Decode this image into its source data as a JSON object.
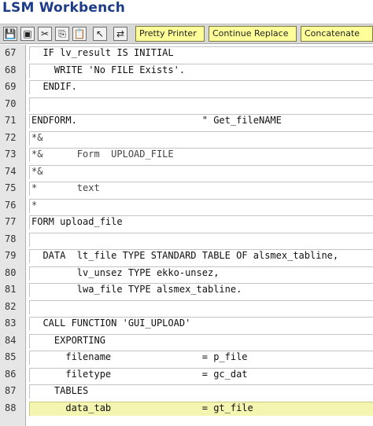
{
  "app": {
    "title": "LSM Workbench"
  },
  "toolbar": {
    "icons": [
      {
        "name": "save-icon",
        "glyph": "💾"
      },
      {
        "name": "window-icon",
        "glyph": "▣"
      },
      {
        "name": "cut-icon",
        "glyph": "✂"
      },
      {
        "name": "copy-icon",
        "glyph": "⎘"
      },
      {
        "name": "paste-icon",
        "glyph": "📋"
      },
      {
        "name": "pointer-icon",
        "glyph": "↖"
      },
      {
        "name": "replace-icon",
        "glyph": "⇄"
      }
    ],
    "buttons": [
      {
        "name": "pretty-printer-button",
        "label": "Pretty Printer"
      },
      {
        "name": "continue-replace-button",
        "label": "Continue Replace"
      },
      {
        "name": "concatenate-button",
        "label": "Concatenate"
      }
    ]
  },
  "editor": {
    "highlight_color": "#f3f5b0",
    "lines": [
      {
        "num": "67",
        "text": "  IF lv_result IS INITIAL"
      },
      {
        "num": "68",
        "text": "    WRITE 'No FILE Exists'."
      },
      {
        "num": "69",
        "text": "  ENDIF."
      },
      {
        "num": "70",
        "text": ""
      },
      {
        "num": "71",
        "text": "ENDFORM.                      \" Get_fileNAME"
      },
      {
        "num": "72",
        "text": "*&"
      },
      {
        "num": "73",
        "text": "*&      Form  UPLOAD_FILE"
      },
      {
        "num": "74",
        "text": "*&"
      },
      {
        "num": "75",
        "text": "*       text"
      },
      {
        "num": "76",
        "text": "*"
      },
      {
        "num": "77",
        "text": "FORM upload_file"
      },
      {
        "num": "78",
        "text": ""
      },
      {
        "num": "79",
        "text": "  DATA  lt_file TYPE STANDARD TABLE OF alsmex_tabline,"
      },
      {
        "num": "80",
        "text": "        lv_unsez TYPE ekko-unsez,"
      },
      {
        "num": "81",
        "text": "        lwa_file TYPE alsmex_tabline."
      },
      {
        "num": "82",
        "text": ""
      },
      {
        "num": "83",
        "text": "  CALL FUNCTION 'GUI_UPLOAD'"
      },
      {
        "num": "84",
        "text": "    EXPORTING"
      },
      {
        "num": "85",
        "text": "      filename                = p_file"
      },
      {
        "num": "86",
        "text": "      filetype                = gc_dat"
      },
      {
        "num": "87",
        "text": "    TABLES"
      },
      {
        "num": "88",
        "text": "      data_tab                = gt_file",
        "highlighted": true
      }
    ]
  }
}
